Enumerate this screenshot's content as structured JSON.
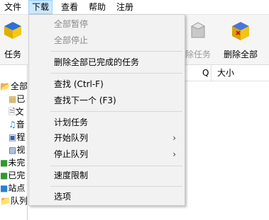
{
  "menubar": {
    "items": [
      {
        "label": "文件"
      },
      {
        "label": "下载"
      },
      {
        "label": "查看"
      },
      {
        "label": "帮助"
      },
      {
        "label": "注册"
      }
    ]
  },
  "toolbar": {
    "left_label": "任务",
    "delete_task_label": "除任务",
    "delete_all_label": "删除全部"
  },
  "tree": {
    "items": [
      {
        "label": "全部"
      },
      {
        "label": "已"
      },
      {
        "label": "文"
      },
      {
        "label": "音"
      },
      {
        "label": "程"
      },
      {
        "label": "视"
      },
      {
        "label": "未完"
      },
      {
        "label": "已完"
      },
      {
        "label": "站点"
      },
      {
        "label": "队列"
      }
    ]
  },
  "list_header": {
    "q_label": "Q",
    "size_label": "大小"
  },
  "download_menu": {
    "pause_all": "全部暂停",
    "stop_all": "全部停止",
    "delete_completed": "删除全部已完成的任务",
    "find": "查找 (Ctrl-F)",
    "find_next": "查找下一个 (F3)",
    "scheduler": "计划任务",
    "start_queue": "开始队列",
    "stop_queue": "停止队列",
    "speed_limit": "速度限制",
    "options": "选项"
  }
}
